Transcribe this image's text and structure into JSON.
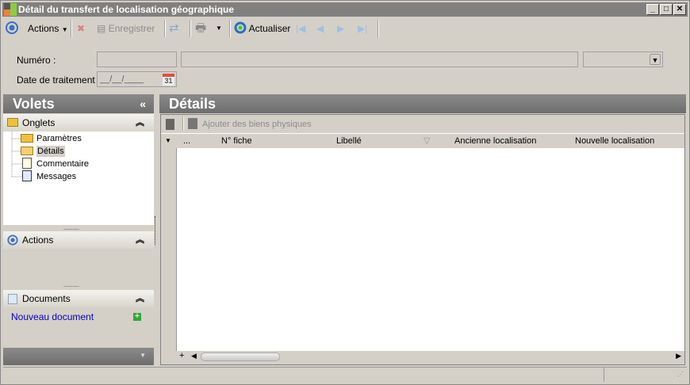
{
  "window": {
    "title": "Détail du transfert de localisation géographique",
    "min": "_",
    "max": "□",
    "close": "✕"
  },
  "toolbar": {
    "actions": "Actions",
    "save": "Enregistrer",
    "refresh": "Actualiser"
  },
  "form": {
    "numero_label": "Numéro :",
    "date_label": "Date de traitement :",
    "date_value": "__/__/____",
    "calendar_day": "31"
  },
  "left": {
    "title": "Volets",
    "collapse": "«",
    "onglets": {
      "title": "Onglets",
      "items": [
        "Paramètres",
        "Détails",
        "Commentaire",
        "Messages"
      ],
      "selected": "Détails"
    },
    "actions": {
      "title": "Actions"
    },
    "documents": {
      "title": "Documents",
      "new_doc": "Nouveau document"
    }
  },
  "right": {
    "title": "Détails",
    "add_label": "Ajouter des biens physiques",
    "columns": [
      "...",
      "N° fiche",
      "Libellé",
      "Ancienne localisation",
      "Nouvelle localisation"
    ],
    "rows": []
  },
  "colors": {
    "header": "#7b7b7b",
    "link": "#0000cc",
    "selected": "#d4d0c8"
  }
}
